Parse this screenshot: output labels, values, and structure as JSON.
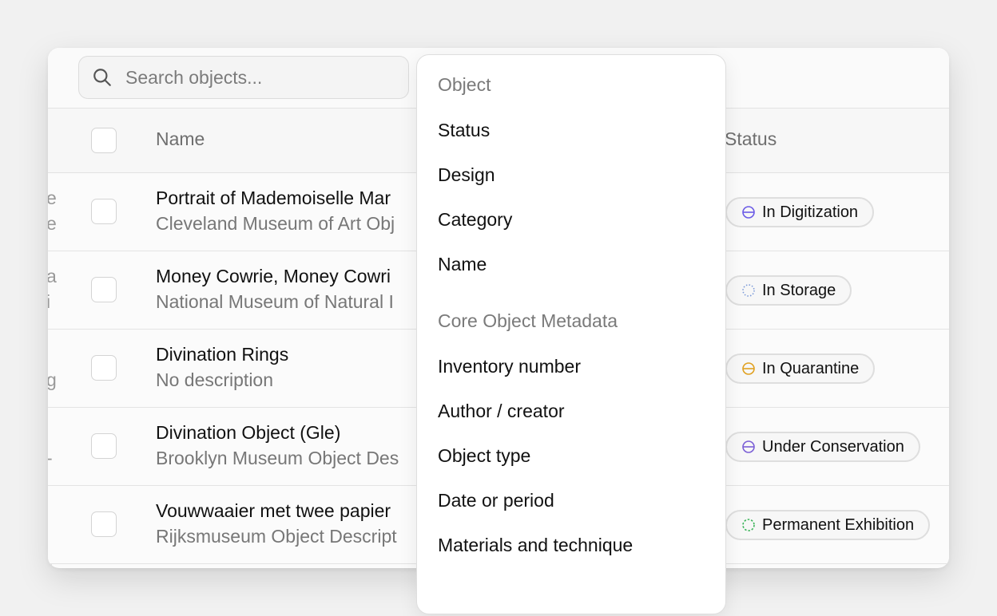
{
  "search": {
    "placeholder": "Search objects..."
  },
  "table": {
    "headers": {
      "name": "Name",
      "status": "Status"
    },
    "edge_fragments": [
      "e",
      "e",
      "a",
      "i",
      "g",
      "-"
    ],
    "rows": [
      {
        "title": "Portrait of Mademoiselle Mar",
        "subtitle": "Cleveland Museum of Art Obj",
        "status": "In Digitization"
      },
      {
        "title": "Money Cowrie, Money Cowri",
        "subtitle": "National Museum of Natural I",
        "status": "In Storage"
      },
      {
        "title": "Divination Rings",
        "subtitle": "No description",
        "status": "In Quarantine"
      },
      {
        "title": "Divination Object (Gle)",
        "subtitle": "Brooklyn Museum Object Des",
        "status": "Under Conservation"
      },
      {
        "title": "Vouwwaaier met twee papier",
        "subtitle": "Rijksmuseum Object Descript",
        "status": "Permanent Exhibition"
      }
    ]
  },
  "status_colors": {
    "In Digitization": "#6b5be6",
    "In Storage": "#7c9ad8",
    "In Quarantine": "#e0a020",
    "Under Conservation": "#7b5fd6",
    "Permanent Exhibition": "#3cb45a"
  },
  "dropdown": {
    "groups": [
      {
        "label": "Object",
        "items": [
          "Status",
          "Design",
          "Category",
          "Name"
        ]
      },
      {
        "label": "Core Object Metadata",
        "items": [
          "Inventory number",
          "Author / creator",
          "Object type",
          "Date or period",
          "Materials and technique"
        ]
      }
    ]
  }
}
